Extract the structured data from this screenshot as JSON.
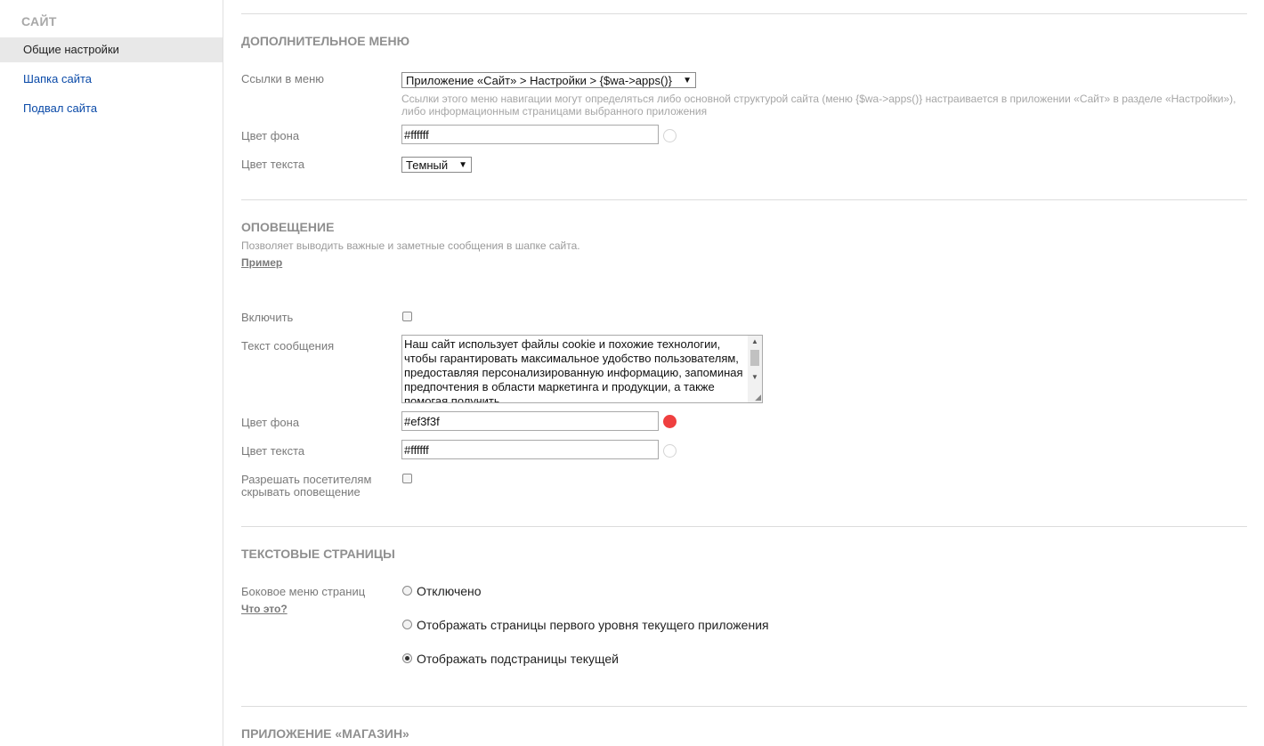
{
  "sidebar": {
    "title": "САЙТ",
    "items": [
      {
        "label": "Общие настройки",
        "active": true
      },
      {
        "label": "Шапка сайта",
        "active": false
      },
      {
        "label": "Подвал сайта",
        "active": false
      }
    ]
  },
  "extra_menu": {
    "title": "ДОПОЛНИТЕЛЬНОЕ МЕНЮ",
    "links_label": "Ссылки в меню",
    "links_value": "Приложение «Сайт» > Настройки > {$wa->apps()}",
    "links_hint_1": "Ссылки этого меню навигации могут определяться либо основной структурой сайта (меню {$wa->apps()} настраивается в приложении «Сайт» в разделе «Настройки»),",
    "links_hint_2": "либо информационным страницами выбранного приложения",
    "bg_label": "Цвет фона",
    "bg_value": "#ffffff",
    "bg_swatch": "#ffffff",
    "text_label": "Цвет текста",
    "text_value": "Темный"
  },
  "notification": {
    "title": "ОПОВЕЩЕНИЕ",
    "desc": "Позволяет выводить важные и заметные сообщения в шапке сайта.",
    "example_link": "Пример",
    "enable_label": "Включить",
    "enable_checked": false,
    "message_label": "Текст сообщения",
    "message_value": "Наш сайт использует файлы cookie и похожие технологии, чтобы гарантировать максимальное удобство пользователям, предоставляя персонализированную информацию, запоминая предпочтения в области маркетинга и продукции, а также помогая получить",
    "bg_label": "Цвет фона",
    "bg_value": "#ef3f3f",
    "bg_swatch": "#ef3f3f",
    "text_label": "Цвет текста",
    "text_value": "#ffffff",
    "text_swatch": "#ffffff",
    "allow_hide_label_1": "Разрешать посетителям",
    "allow_hide_label_2": "скрывать оповещение",
    "allow_hide_checked": false
  },
  "text_pages": {
    "title": "ТЕКСТОВЫЕ СТРАНИЦЫ",
    "side_menu_label": "Боковое меню страниц",
    "what_link": "Что это?",
    "options": [
      {
        "label": "Отключено",
        "checked": false
      },
      {
        "label": "Отображать страницы первого уровня текущего приложения",
        "checked": false
      },
      {
        "label": "Отображать подстраницы текущей",
        "checked": true
      }
    ]
  },
  "shop_app": {
    "title": "ПРИЛОЖЕНИЕ «МАГАЗИН»"
  }
}
